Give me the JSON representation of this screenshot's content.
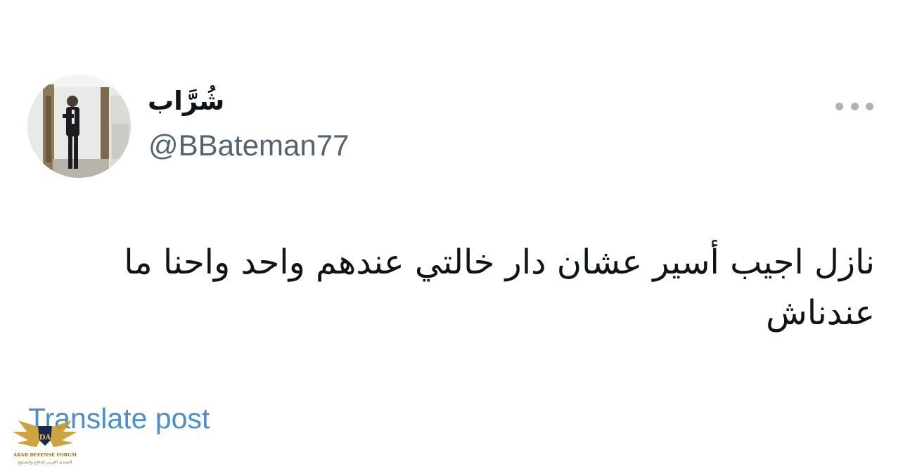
{
  "tweet": {
    "author": {
      "display_name": "شُرَّاب",
      "handle": "@BBateman77",
      "avatar_icon": "profile-photo"
    },
    "more_icon": "more-horizontal-icon",
    "text": "نازل اجيب أسير عشان دار خالتي عندهم واحد واحنا ما عندناش",
    "translate_label": "Translate post"
  },
  "watermark": {
    "emblem_text": "DA",
    "text_en": "ARAB DEFENSE FORUM",
    "text_ar": "المنتدى العربي للدفاع والتسليح"
  },
  "colors": {
    "text_primary": "#0f1419",
    "text_secondary": "#536471",
    "link": "#4c8fca",
    "more_dots": "#aab4bd",
    "watermark_gold": "#c99a2e"
  }
}
